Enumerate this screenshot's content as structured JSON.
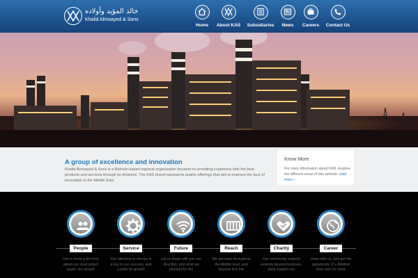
{
  "logo": {
    "arabic_name": "خالد المؤيد وأولاده",
    "english_name": "Khalid Almoayed & Sons"
  },
  "nav": [
    {
      "label": "Home",
      "icon": "home-icon"
    },
    {
      "label": "About KAS",
      "icon": "kas-logo-icon"
    },
    {
      "label": "Subsidiaries",
      "icon": "building-icon"
    },
    {
      "label": "News",
      "icon": "newspaper-icon"
    },
    {
      "label": "Careers",
      "icon": "briefcase-icon"
    },
    {
      "label": "Contact Us",
      "icon": "phone-icon"
    }
  ],
  "intro": {
    "title": "A group of excellence and innovation",
    "text": "Khalid Almoayed & Sons is a Bahrain-based regional organization focused on providing customers with the best products and services through its divisions. The KAS brand represents quality offerings that aim to improve the face of innovation in the Middle East."
  },
  "know_more": {
    "title": "Know More",
    "text": "For more information about KAS, Explore the different areas of this website.",
    "link": "read more ›"
  },
  "features": [
    {
      "label": "People",
      "icon": "people-icon",
      "desc": "Get to know a bit more about our most prized asset, our people"
    },
    {
      "label": "Service",
      "icon": "gear-icon",
      "desc": "Our attention to service is a key to our success, and a pillar for growth"
    },
    {
      "label": "Future",
      "icon": "signal-icon",
      "desc": "Let us share with you our direction, and what we planned for the"
    },
    {
      "label": "Reach",
      "icon": "grid-icon",
      "desc": "We are base throughout the Middle East, and beyond find the"
    },
    {
      "label": "Charity",
      "icon": "heart-hands-icon",
      "desc": "Our community support extends beyond business. Help support our"
    },
    {
      "label": "Career",
      "icon": "globe-icon",
      "desc": "Grow with us, and get the opportunity of a lifetime! click here for more"
    }
  ],
  "colors": {
    "header_blue": "#1b4f8a",
    "accent_blue": "#2a77b8",
    "ring_blue": "#2b86c8"
  }
}
